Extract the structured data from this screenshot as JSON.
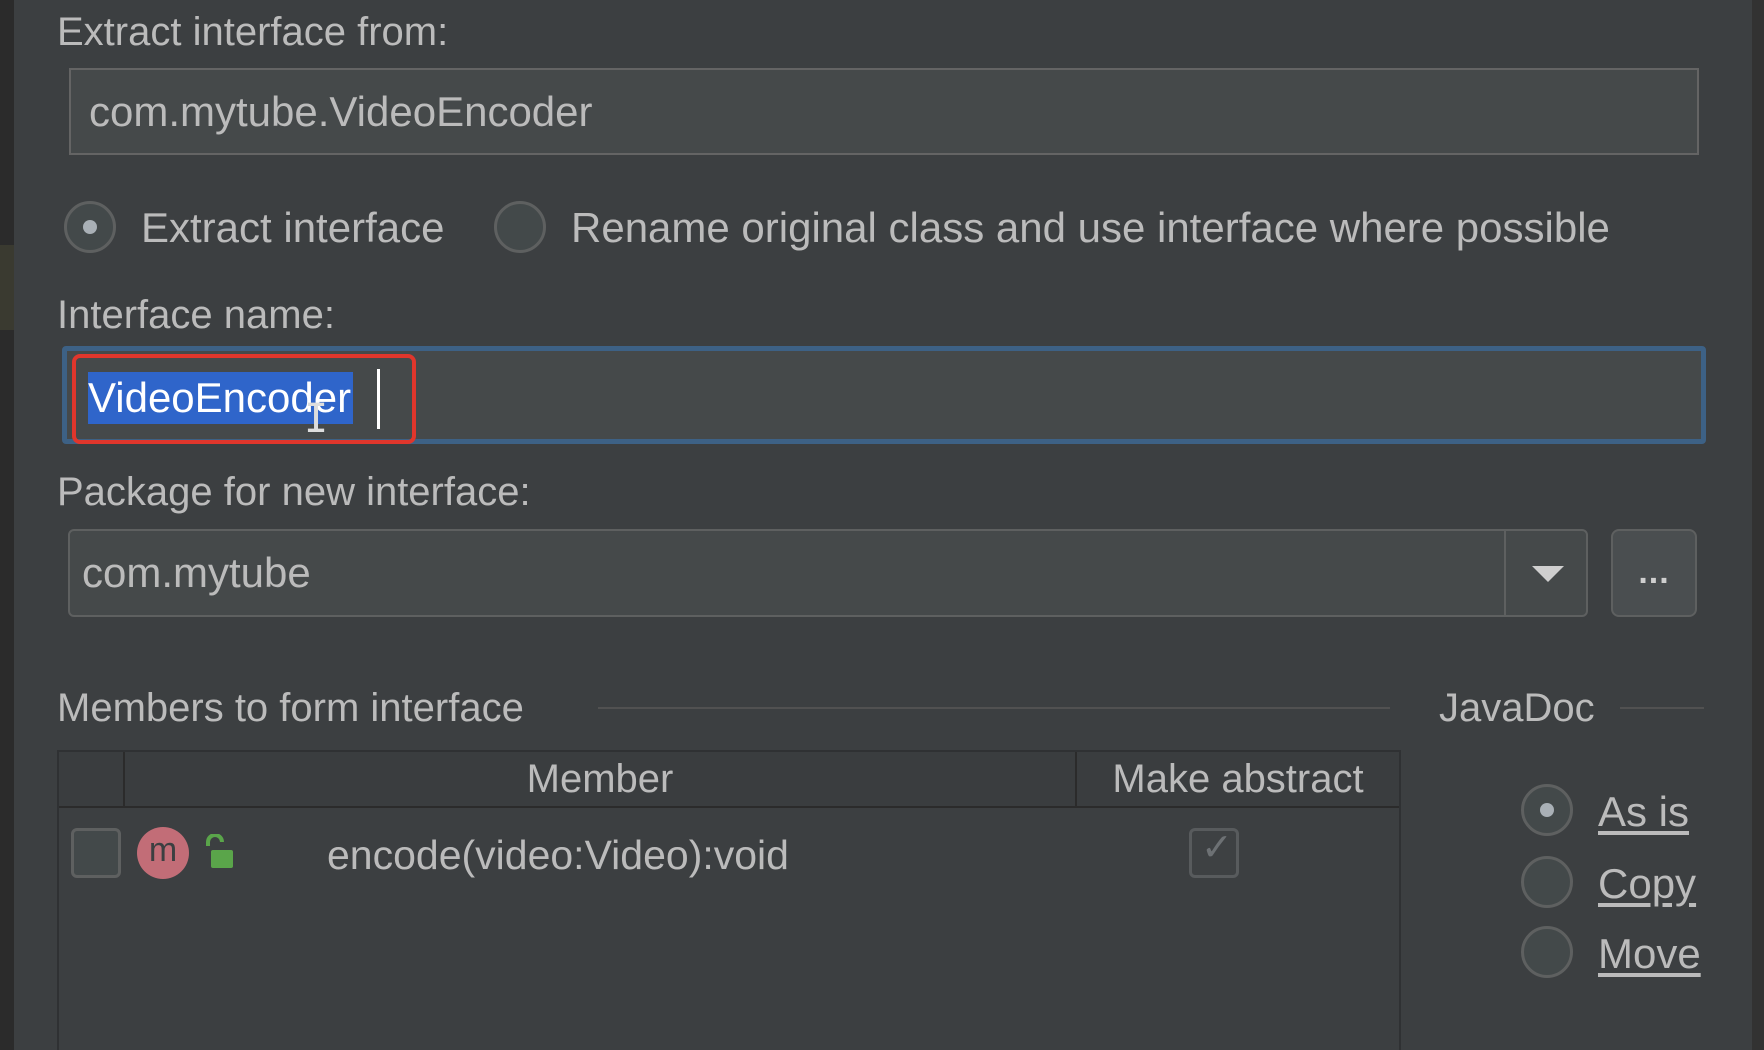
{
  "extract_from": {
    "label": "Extract interface from:",
    "value": "com.mytube.VideoEncoder"
  },
  "mode": {
    "extract_label": "Extract interface",
    "rename_label": "Rename original class and use interface where possible",
    "selected": "extract"
  },
  "interface_name": {
    "label": "Interface name:",
    "value": "VideoEncoder"
  },
  "package": {
    "label": "Package for new interface:",
    "value": "com.mytube",
    "browse_label": "..."
  },
  "members": {
    "section_title": "Members to form interface",
    "columns": [
      "Member",
      "Make abstract"
    ],
    "rows": [
      {
        "checked": false,
        "icon": "method-icon",
        "icon_letter": "m",
        "visibility_icon": "public-lock-icon",
        "member": "encode(video:Video):void",
        "make_abstract": true
      }
    ]
  },
  "javadoc": {
    "section_title": "JavaDoc",
    "options": [
      "As is",
      "Copy",
      "Move"
    ],
    "selected": "As is"
  },
  "colors": {
    "accent_focus": "#3d6185",
    "selection": "#2f65ca",
    "annotation_box": "#e0362c",
    "method_icon": "#c26d77",
    "lock_icon": "#5aa54a"
  }
}
